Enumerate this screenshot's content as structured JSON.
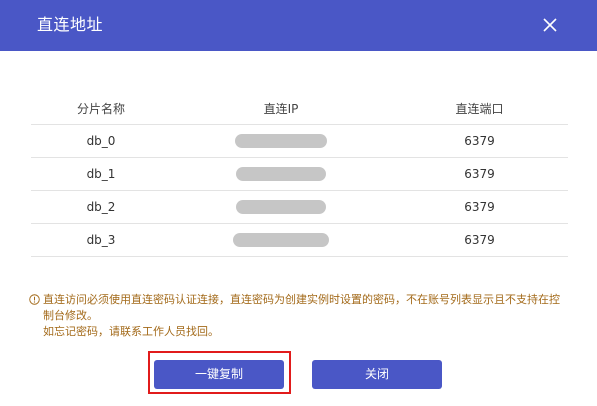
{
  "dialog": {
    "title": "直连地址",
    "close_icon": "close-icon",
    "header_color": "#4a57c6"
  },
  "table": {
    "headers": [
      "分片名称",
      "直连IP",
      "直连端口"
    ],
    "rows": [
      {
        "name": "db_0",
        "ip": "",
        "port": "6379"
      },
      {
        "name": "db_1",
        "ip": "",
        "port": "6379"
      },
      {
        "name": "db_2",
        "ip": "",
        "port": "6379"
      },
      {
        "name": "db_3",
        "ip": "",
        "port": "6379"
      }
    ]
  },
  "notice": {
    "icon": "info-circle-icon",
    "line1": "直连访问必须使用直连密码认证连接，直连密码为创建实例时设置的密码，不在账号列表显示且不支持在控制台修改。",
    "line2": "如忘记密码，请联系工作人员找回。",
    "color": "#a36a1a"
  },
  "buttons": {
    "copy_label": "一键复制",
    "close_label": "关闭",
    "accent": "#4a57c6",
    "highlight_color": "#e11b1b"
  }
}
